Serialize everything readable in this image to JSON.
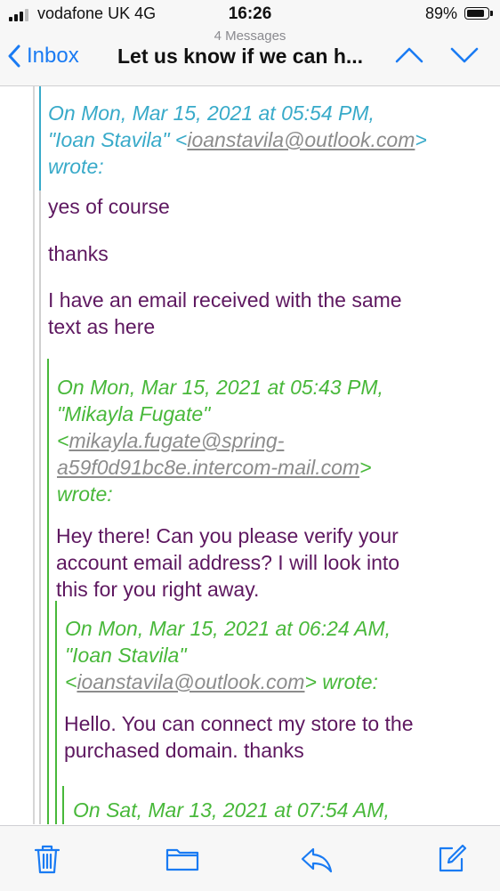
{
  "status_bar": {
    "carrier": "vodafone UK  4G",
    "time": "16:26",
    "battery_percent": "89%",
    "battery_level": 0.89
  },
  "nav": {
    "back_label": "Inbox",
    "message_count": "4 Messages",
    "subject": "Let us know if we can h..."
  },
  "thread": {
    "quote1": {
      "header_a": "On Mon, Mar 15, 2021 at 05:54 PM,",
      "header_b": "\"Ioan Stavila\" <",
      "email": "ioanstavila@outlook.com",
      "header_c": ">",
      "header_d": "wrote:"
    },
    "reply1": {
      "line1": "yes of course",
      "line2": "thanks",
      "line3": "I have an email received with the same",
      "line4": "text as here"
    },
    "quote2": {
      "header_a": "On Mon, Mar 15, 2021 at 05:43 PM,",
      "header_b": "\"Mikayla Fugate\"",
      "lt": "<",
      "email_a": "mikayla.fugate@spring-",
      "email_b": "a59f0d91bc8e.intercom-mail.com",
      "gt": ">",
      "header_c": "wrote:"
    },
    "reply2": {
      "line1": "Hey there! Can you please verify your",
      "line2": "account email address? I will look into",
      "line3": "this for you right away."
    },
    "quote3": {
      "header_a": "On Mon, Mar 15, 2021 at 06:24 AM,",
      "header_b": "\"Ioan Stavila\"",
      "lt": "<",
      "email": "ioanstavila@outlook.com",
      "gt": "> wrote:"
    },
    "reply3": {
      "line1": "Hello. You can connect my store to the",
      "line2": "purchased domain. thanks"
    },
    "quote4": {
      "header_a": "On Sat, Mar 13, 2021 at 07:54 AM,"
    }
  },
  "toolbar": {
    "icons": [
      "trash-icon",
      "folder-icon",
      "reply-icon",
      "compose-icon"
    ]
  },
  "colors": {
    "ios_blue": "#1a7bf3",
    "body_text": "#5e1860",
    "quote_teal": "#38aac9",
    "quote_green": "#48b83a"
  }
}
